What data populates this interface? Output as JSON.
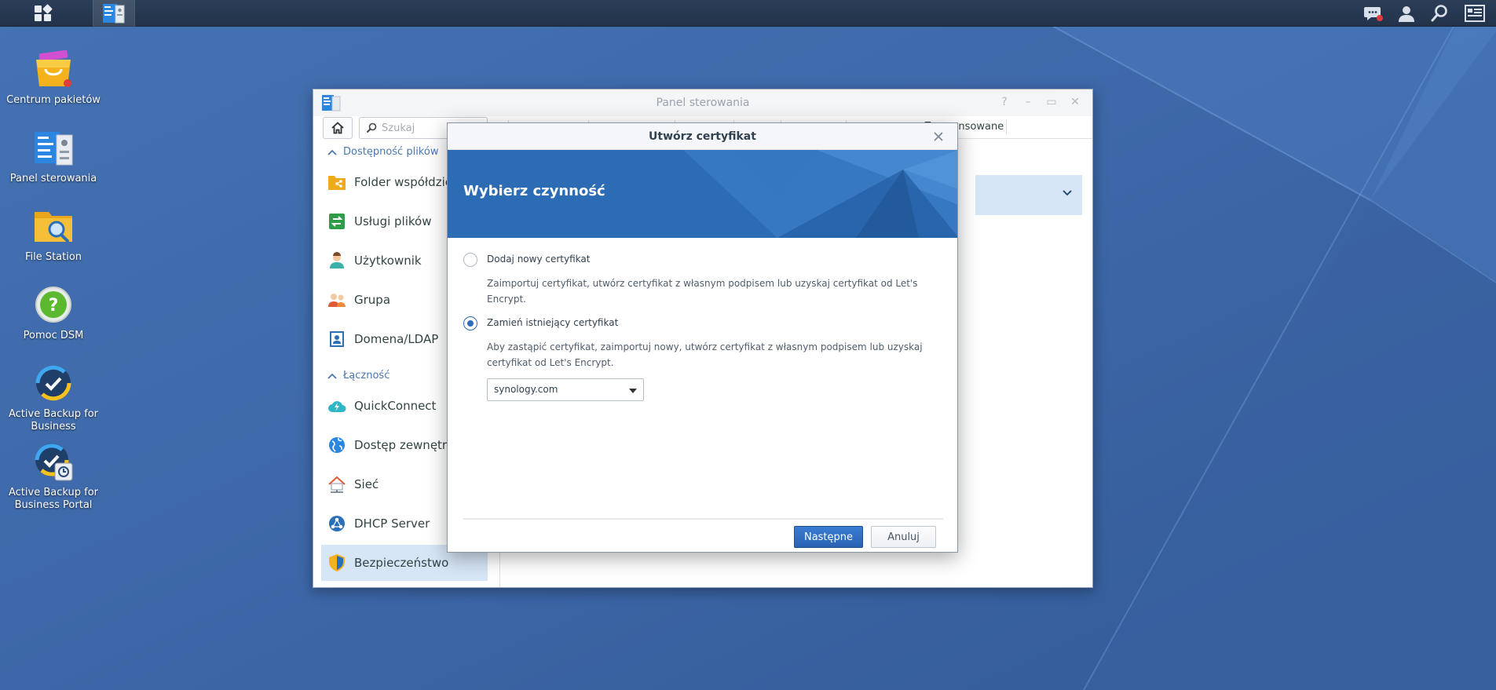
{
  "desktop": {
    "icons": [
      {
        "label": "Centrum pakietów",
        "icon": "package-center-icon"
      },
      {
        "label": "Panel sterowania",
        "icon": "control-panel-icon"
      },
      {
        "label": "File Station",
        "icon": "file-station-icon"
      },
      {
        "label": "Pomoc DSM",
        "icon": "help-icon"
      },
      {
        "label": "Active Backup for Business",
        "icon": "active-backup-icon"
      },
      {
        "label": "Active Backup for Business Portal",
        "icon": "active-backup-portal-icon"
      }
    ]
  },
  "taskbar": {
    "left": [
      "main-menu-icon",
      "control-panel-icon"
    ],
    "right": [
      "notifications-icon",
      "user-icon",
      "search-icon",
      "widgets-icon"
    ]
  },
  "control_panel": {
    "title": "Panel sterowania",
    "search_placeholder": "Szukaj",
    "sections": [
      {
        "title": "Dostępność plików",
        "items": [
          "Folder współdzielony",
          "Usługi plików",
          "Użytkownik",
          "Grupa",
          "Domena/LDAP"
        ]
      },
      {
        "title": "Łączność",
        "items": [
          "QuickConnect",
          "Dostęp zewnętrzny",
          "Sieć",
          "DHCP Server",
          "Bezpieczeństwo"
        ]
      }
    ],
    "active_item": "Bezpieczeństwo",
    "tab_visible": "Zaawansowane"
  },
  "dialog": {
    "title": "Utwórz certyfikat",
    "banner_title": "Wybierz czynność",
    "options": [
      {
        "label": "Dodaj nowy certyfikat",
        "description": "Zaimportuj certyfikat, utwórz certyfikat z własnym podpisem lub uzyskaj certyfikat od Let's Encrypt.",
        "checked": false
      },
      {
        "label": "Zamień istniejący certyfikat",
        "description": "Aby zastąpić certyfikat, zaimportuj nowy, utwórz certyfikat z własnym podpisem lub uzyskaj certyfikat od Let's Encrypt.",
        "checked": true
      }
    ],
    "certificate_select": "synology.com",
    "next_label": "Następne",
    "cancel_label": "Anuluj"
  }
}
